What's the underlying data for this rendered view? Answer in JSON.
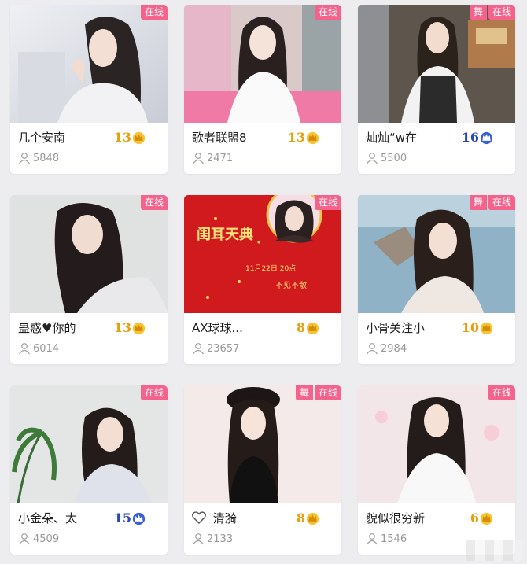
{
  "status_label": "在线",
  "dance_label": "舞",
  "colors": {
    "badge": "#f4638c",
    "level_gold": "#e4a010",
    "level_blue": "#2a45c0",
    "viewer_text": "#9a9a9a"
  },
  "cards": [
    {
      "name": "几个安南",
      "level": "13",
      "level_color": "gold",
      "viewers": "5848",
      "dance": false,
      "heart": false
    },
    {
      "name": "歌者联盟8",
      "level": "13",
      "level_color": "gold",
      "viewers": "2471",
      "dance": false,
      "heart": false
    },
    {
      "name": "灿灿“w在",
      "level": "16",
      "level_color": "blue",
      "viewers": "5500",
      "dance": true,
      "heart": false
    },
    {
      "name": "蛊惑♥你的",
      "level": "13",
      "level_color": "gold",
      "viewers": "6014",
      "dance": false,
      "heart": false
    },
    {
      "name": "AX球球...",
      "level": "8",
      "level_color": "gold",
      "viewers": "23657",
      "dance": false,
      "heart": false
    },
    {
      "name": "小骨关注小",
      "level": "10",
      "level_color": "gold",
      "viewers": "2984",
      "dance": true,
      "heart": false
    },
    {
      "name": "小金朵、太",
      "level": "15",
      "level_color": "blue",
      "viewers": "4509",
      "dance": false,
      "heart": false
    },
    {
      "name": "清漪",
      "level": "8",
      "level_color": "gold",
      "viewers": "2133",
      "dance": true,
      "heart": true
    },
    {
      "name": "貌似很穷新",
      "level": "6",
      "level_color": "gold",
      "viewers": "1546",
      "dance": false,
      "heart": false
    }
  ],
  "poster": {
    "line1": "闺耳天典",
    "line2": "11月22日 20点",
    "line3": "不见不散"
  }
}
